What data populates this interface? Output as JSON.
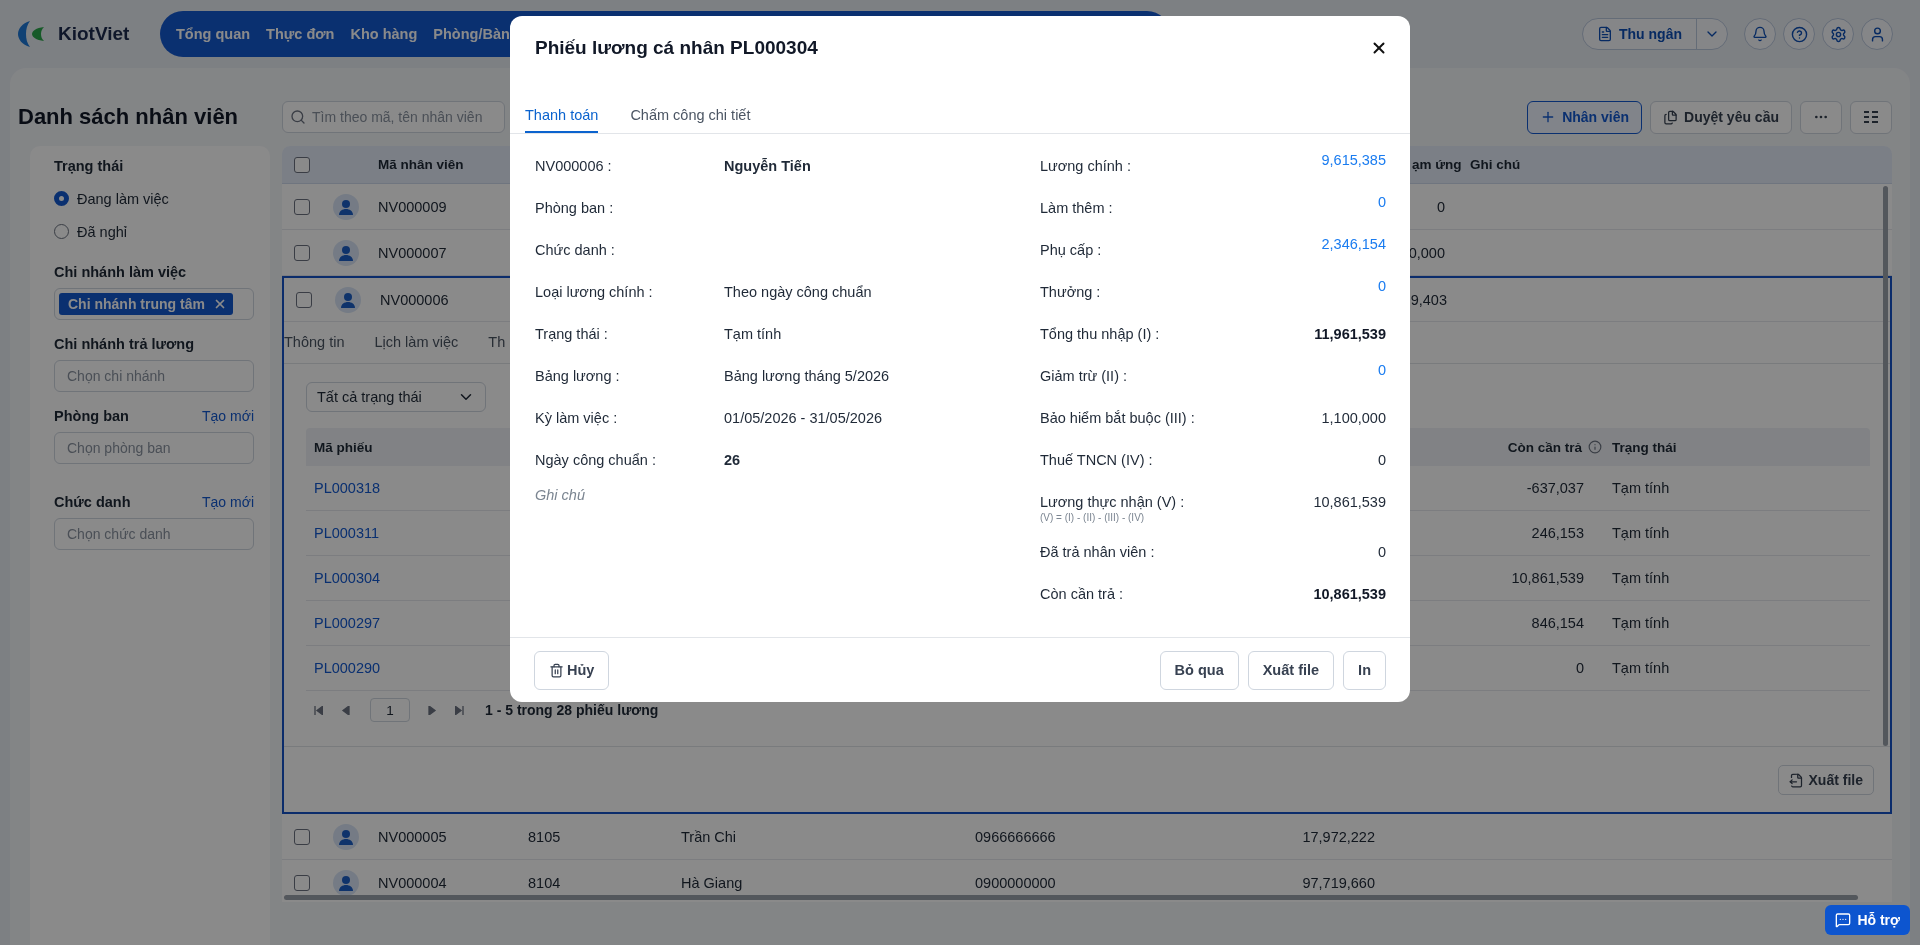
{
  "app": {
    "logo": "KiotViet",
    "nav": [
      "Tổng quan",
      "Thực đơn",
      "Kho hàng",
      "Phòng/Bàn"
    ],
    "cashier": "Thu ngân"
  },
  "page": {
    "title": "Danh sách nhân viên",
    "search_placeholder": "Tìm theo mã, tên nhân viên",
    "add_button": "Nhân viên",
    "approve_button": "Duyệt yêu cầu"
  },
  "filters": {
    "status": {
      "title": "Trạng thái",
      "options": [
        {
          "label": "Đang làm việc",
          "selected": true
        },
        {
          "label": "Đã nghỉ",
          "selected": false
        }
      ]
    },
    "work_branch": {
      "title": "Chi nhánh làm việc",
      "tags": [
        "Chi nhánh trung tâm"
      ]
    },
    "pay_branch": {
      "title": "Chi nhánh trả lương",
      "placeholder": "Chọn chi nhánh"
    },
    "department": {
      "title": "Phòng ban",
      "link": "Tạo mới",
      "placeholder": "Chọn phòng ban"
    },
    "job_title": {
      "title": "Chức danh",
      "link": "Tạo mới",
      "placeholder": "Chọn chức danh"
    }
  },
  "table": {
    "all_checked": false,
    "columns": {
      "code": "Mã nhân viên",
      "advance": "ạm ứng",
      "note": "Ghi chú"
    },
    "rows": [
      {
        "code": "NV000009",
        "advance": "0",
        "checked": false,
        "expanded": false
      },
      {
        "code": "NV000007",
        "advance": "0,000",
        "checked": false,
        "expanded": false
      },
      {
        "code": "NV000006",
        "advance": "9,403",
        "checked": false,
        "expanded": true,
        "detail": {
          "tabs": [
            {
              "label": "Thông tin",
              "selected": false
            },
            {
              "label": "Lịch làm việc",
              "selected": false
            },
            {
              "label": "Th",
              "selected": false
            }
          ],
          "filter": "Tất cả trạng thái",
          "columns": {
            "code": "Mã phiếu",
            "remaining": "Còn cần trả",
            "status": "Trạng thái"
          },
          "payslips": [
            {
              "code": "PL000318",
              "remaining": "-637,037",
              "status": "Tạm tính"
            },
            {
              "code": "PL000311",
              "remaining": "246,153",
              "status": "Tạm tính"
            },
            {
              "code": "PL000304",
              "remaining": "10,861,539",
              "status": "Tạm tính"
            },
            {
              "code": "PL000297",
              "remaining": "846,154",
              "status": "Tạm tính"
            },
            {
              "code": "PL000290",
              "remaining": "0",
              "status": "Tạm tính"
            }
          ],
          "page": "1",
          "summary": "1 - 5 trong 28 phiếu lương",
          "export": "Xuất file"
        }
      },
      {
        "code": "NV000005",
        "column_2": "8105",
        "name": "Trần Chi",
        "phone": "0966666666",
        "amount": "17,972,222",
        "checked": false,
        "expanded": false
      },
      {
        "code": "NV000004",
        "column_2": "8104",
        "name": "Hà Giang",
        "phone": "0900000000",
        "amount": "97,719,660",
        "checked": false,
        "expanded": false
      }
    ]
  },
  "modal": {
    "title": "Phiếu lương cá nhân PL000304",
    "tabs": [
      {
        "label": "Thanh toán",
        "selected": true
      },
      {
        "label": "Chấm công chi tiết",
        "selected": false
      }
    ],
    "info": [
      {
        "label": "NV000006 :",
        "value": "Nguyễn Tiến",
        "kind": "bold"
      },
      {
        "label": "Phòng ban :"
      },
      {
        "label": "Chức danh :"
      },
      {
        "label": "Loại lương chính :",
        "value": "Theo ngày công chuẩn",
        "kind": "plain"
      },
      {
        "label": "Trạng thái :",
        "value": "Tạm tính",
        "kind": "plain"
      },
      {
        "label": "Bảng lương :",
        "value": "Bảng lương tháng 5/2026",
        "kind": "plain"
      },
      {
        "label": "Kỳ làm việc :",
        "value": "01/05/2026 - 31/05/2026",
        "kind": "plain"
      },
      {
        "label": "Ngày công chuẩn :",
        "value": "26",
        "kind": "bold"
      }
    ],
    "note_placeholder": "Ghi chú",
    "amounts": [
      {
        "label": "Lương chính :",
        "value": "9,615,385",
        "kind": "link"
      },
      {
        "label": "Làm thêm :",
        "value": "0",
        "kind": "link"
      },
      {
        "label": "Phụ cấp :",
        "value": "2,346,154",
        "kind": "link"
      },
      {
        "label": "Thưởng :",
        "value": "0",
        "kind": "link"
      },
      {
        "label": "Tổng thu nhập (I) :",
        "value": "11,961,539",
        "kind": "bold"
      },
      {
        "label": "Giảm trừ (II) :",
        "value": "0",
        "kind": "link"
      },
      {
        "label": "Bảo hiểm bắt buộc (III) :",
        "value": "1,100,000",
        "kind": "plain"
      },
      {
        "label": "Thuế TNCN (IV) :",
        "value": "0",
        "kind": "plain"
      },
      {
        "label": "Lương thực nhận (V) :",
        "value": "10,861,539",
        "kind": "plain",
        "formula": "(V) = (I) - (II) - (III) - (IV)"
      },
      {
        "label": "Đã trả nhân viên :",
        "value": "0",
        "kind": "plain"
      },
      {
        "label": "Còn cần trả :",
        "value": "10,861,539",
        "kind": "bold"
      }
    ],
    "delete_button": "Hủy",
    "buttons": [
      "Bỏ qua",
      "Xuất file",
      "In"
    ]
  },
  "help_button": "Hỗ trợ"
}
